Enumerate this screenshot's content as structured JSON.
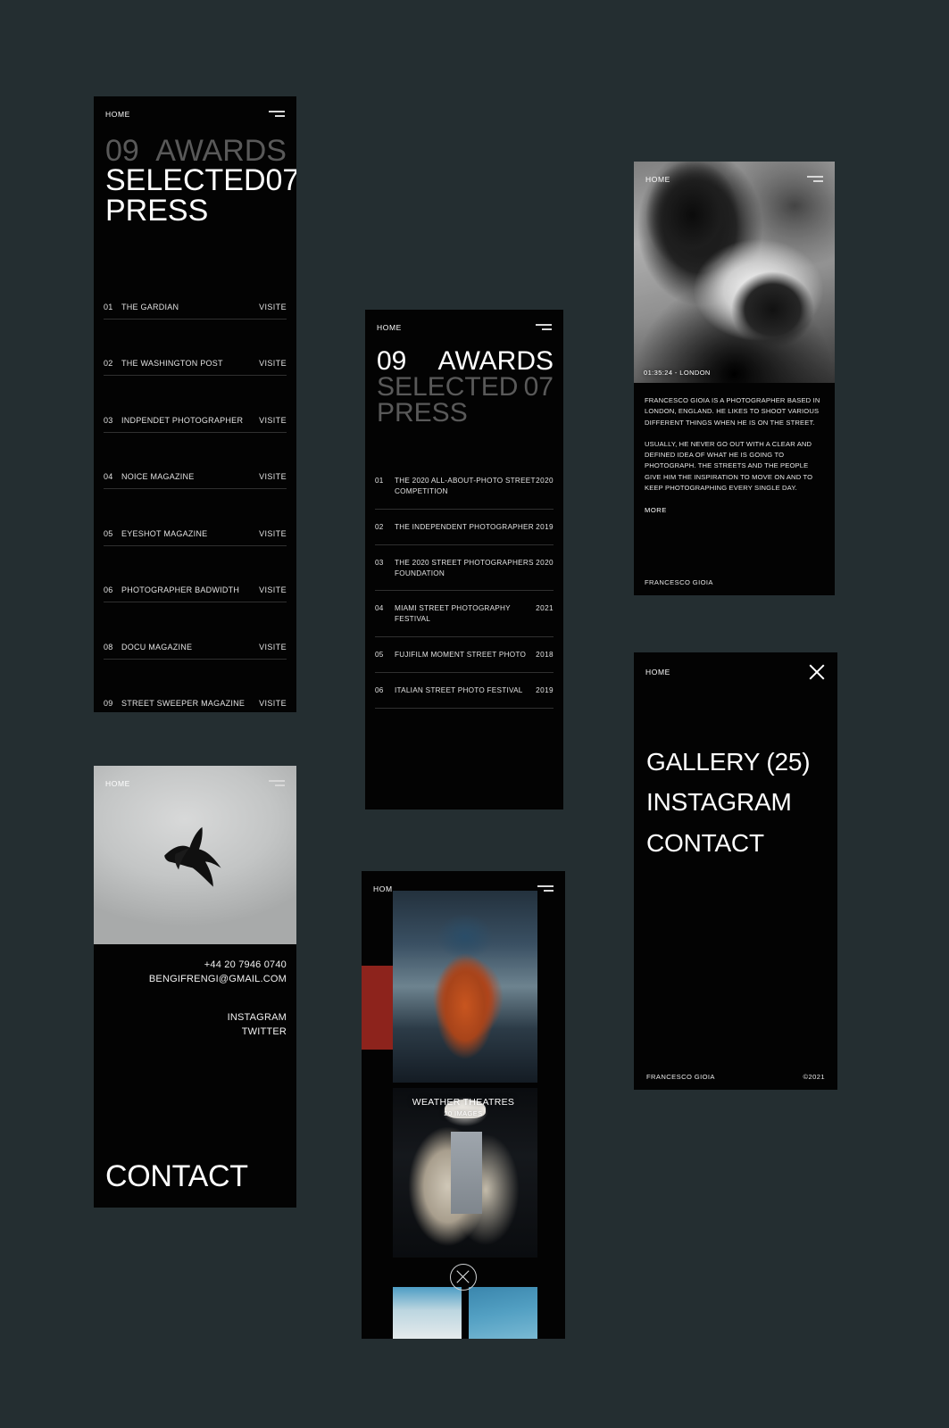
{
  "background_color": "#242e31",
  "press_panel": {
    "home_label": "HOME",
    "menu_icon": "hamburger-icon",
    "headline": {
      "awards_number": "09",
      "awards_label": "AWARDS",
      "press_label_line1": "SELECTED",
      "press_label_line2": "PRESS",
      "press_number": "07"
    },
    "action_label": "VISITE",
    "items": [
      {
        "num": "01",
        "title": "THE GARDIAN",
        "action": "VISITE"
      },
      {
        "num": "02",
        "title": "THE WASHINGTON POST",
        "action": "VISITE"
      },
      {
        "num": "03",
        "title": "INDPENDET PHOTOGRAPHER",
        "action": "VISITE"
      },
      {
        "num": "04",
        "title": "NOICE MAGAZINE",
        "action": "VISITE"
      },
      {
        "num": "05",
        "title": "EYESHOT MAGAZINE",
        "action": "VISITE"
      },
      {
        "num": "06",
        "title": "PHOTOGRAPHER BADWIDTH",
        "action": "VISITE"
      },
      {
        "num": "08",
        "title": "DOCU MAGAZINE",
        "action": "VISITE"
      },
      {
        "num": "09",
        "title": "STREET SWEEPER MAGAZINE",
        "action": "VISITE"
      }
    ]
  },
  "awards_panel": {
    "home_label": "HOME",
    "menu_icon": "hamburger-icon",
    "headline": {
      "awards_number": "09",
      "awards_label": "AWARDS",
      "press_label_line1": "SELECTED",
      "press_label_line2": "PRESS",
      "press_number": "07"
    },
    "items": [
      {
        "num": "01",
        "title": "THE 2020 ALL-ABOUT-PHOTO STREET COMPETITION",
        "year": "2020"
      },
      {
        "num": "02",
        "title": "THE INDEPENDENT PHOTOGRAPHER",
        "year": "2019"
      },
      {
        "num": "03",
        "title": "THE 2020 STREET PHOTOGRAPHERS FOUNDATION",
        "year": "2020"
      },
      {
        "num": "04",
        "title": "MIAMI STREET PHOTOGRAPHY FESTIVAL",
        "year": "2021"
      },
      {
        "num": "05",
        "title": "FUJIFILM MOMENT STREET PHOTO",
        "year": "2018"
      },
      {
        "num": "06",
        "title": "ITALIAN STREET PHOTO FESTIVAL",
        "year": "2019"
      }
    ]
  },
  "about_panel": {
    "home_label": "HOME",
    "menu_icon": "hamburger-icon",
    "photo_caption": "01:35:24 - LONDON",
    "paragraph_1": "FRANCESCO GIOIA IS A PHOTOGRAPHER BASED IN LONDON, ENGLAND. HE LIKES TO SHOOT VARIOUS DIFFERENT THINGS WHEN HE IS ON THE STREET.",
    "paragraph_2": "USUALLY, HE NEVER GO OUT WITH A CLEAR AND DEFINED IDEA OF WHAT HE IS GOING TO PHOTOGRAPH. THE STREETS AND THE PEOPLE GIVE HIM THE INSPIRATION TO MOVE ON AND TO KEEP PHOTOGRAPHING EVERY SINGLE DAY.",
    "more_label": "MORE",
    "footer_name": "FRANCESCO GIOIA"
  },
  "menu_panel": {
    "home_label": "HOME",
    "close_icon": "close-icon",
    "links": [
      "GALLERY (25)",
      "INSTAGRAM",
      "CONTACT"
    ],
    "footer_name": "FRANCESCO GIOIA",
    "footer_copyright": "©2021"
  },
  "contact_panel": {
    "home_label": "HOME",
    "menu_icon": "hamburger-icon",
    "photo": "bird-in-flight-photo",
    "phone": "+44 20 7946 0740",
    "email": "BENGIFRENGI@GMAIL.COM",
    "social": [
      "INSTAGRAM",
      "TWITTER"
    ],
    "heading": "CONTACT"
  },
  "gallery_panel": {
    "home_label": "HOM",
    "menu_icon": "hamburger-icon",
    "close_icon": "close-icon",
    "hero_photo": "orange-hoodie-street-photo",
    "second_photo": "hat-and-coat-street-photo",
    "overlay_title": "WEATHER THEATRES",
    "overlay_subtitle": "20 IMAGES",
    "thumbnails": [
      "thumbnail-1",
      "thumbnail-2"
    ]
  }
}
